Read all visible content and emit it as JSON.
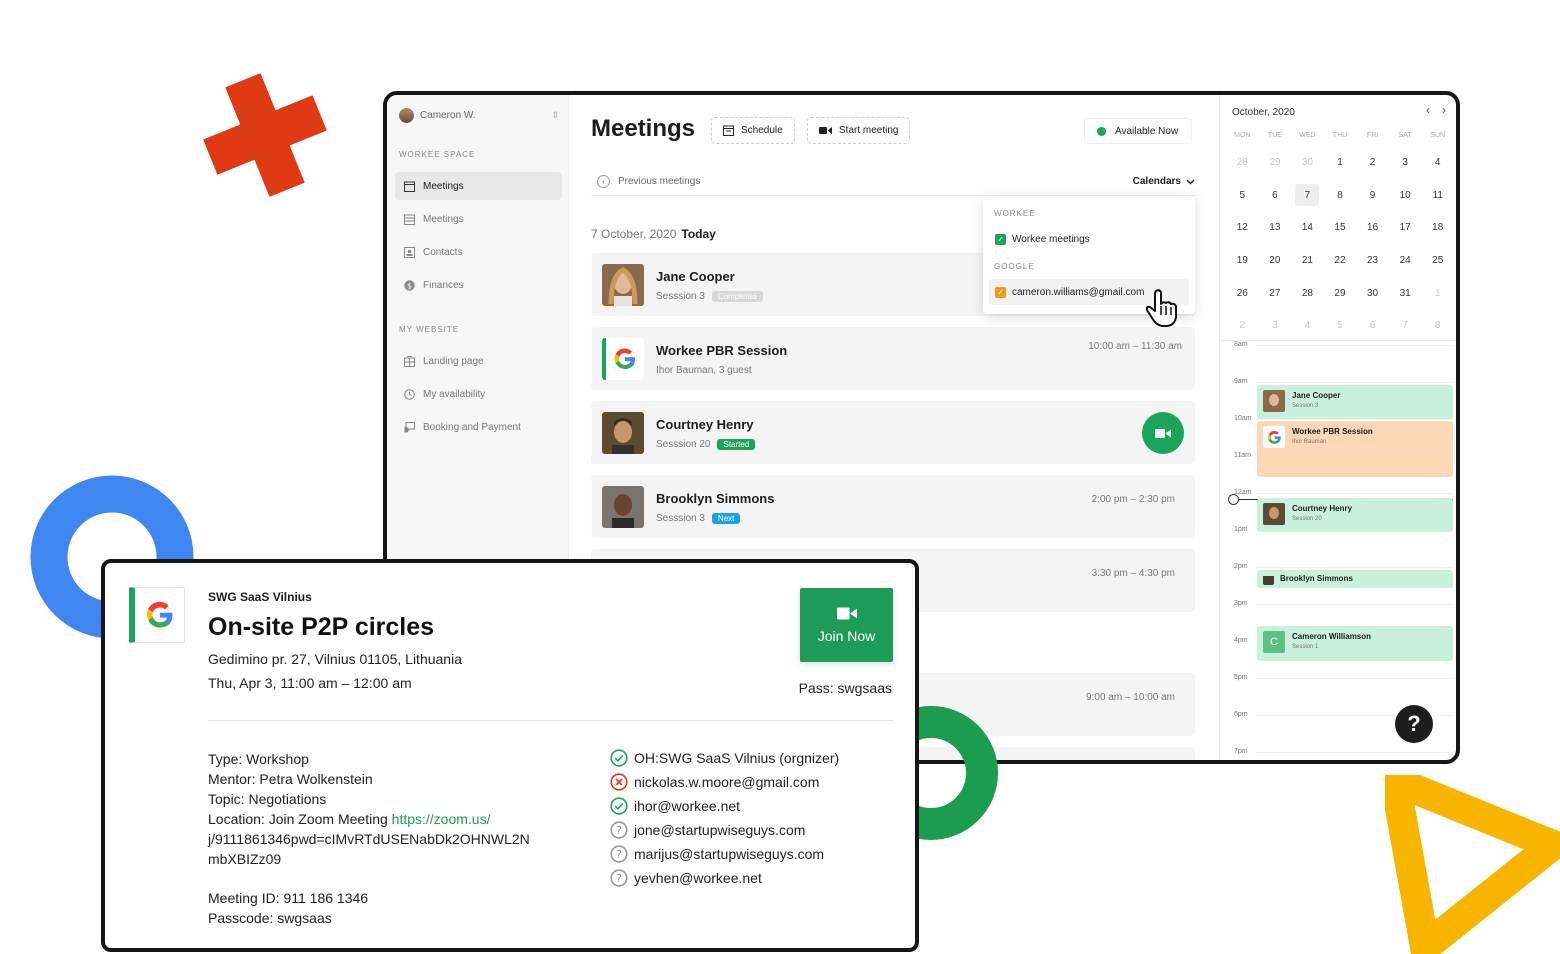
{
  "sidebar": {
    "user_name": "Cameron W.",
    "workspace_label": "WORKEE SPACE",
    "workspace_items": [
      {
        "label": "Meetings",
        "icon": "calendar-icon",
        "active": true
      },
      {
        "label": "Meetings",
        "icon": "calendar-grid-icon",
        "active": false
      },
      {
        "label": "Contacts",
        "icon": "contact-card-icon",
        "active": false
      },
      {
        "label": "Finances",
        "icon": "dollar-icon",
        "active": false
      }
    ],
    "website_label": "MY WEBSITE",
    "website_items": [
      {
        "label": "Landing page",
        "icon": "layout-icon"
      },
      {
        "label": "My availability",
        "icon": "clock-icon"
      },
      {
        "label": "Booking and Payment",
        "icon": "payment-icon"
      }
    ]
  },
  "main": {
    "title": "Meetings",
    "schedule_label": "Schedule",
    "start_meeting_label": "Start meeting",
    "available_label": "Available Now",
    "previous_meetings_label": "Previous meetings",
    "calendars_label": "Calendars",
    "date_label": "7 October, 2020",
    "today_label": "Today",
    "meetings": [
      {
        "name": "Jane Cooper",
        "sub": "Sesssion 3",
        "badge": "Completed",
        "time": ""
      },
      {
        "name": "Workee PBR Session",
        "sub": "Ihor Bauman, 3 guest",
        "badge": "",
        "time": "10:00 am – 11:30 am"
      },
      {
        "name": "Courtney Henry",
        "sub": "Sesssion 20",
        "badge": "Started",
        "time": ""
      },
      {
        "name": "Brooklyn Simmons",
        "sub": "Sesssion 3",
        "badge": "Next",
        "time": "2:00 pm – 2:30 pm"
      },
      {
        "name": "",
        "sub": "",
        "badge": "",
        "time": "3:30 pm – 4:30 pm"
      },
      {
        "name": "",
        "sub": "",
        "badge": "",
        "time": "9:00 am – 10:00 am"
      }
    ],
    "dropdown": {
      "workee_label": "WORKEE",
      "workee_item": "Workee meetings",
      "google_label": "GOOGLE",
      "google_item": "cameron.williams@gmail.com"
    }
  },
  "calendar": {
    "month": "October, 2020",
    "weekdays": [
      "MON",
      "TUE",
      "WED",
      "THU",
      "FRI",
      "SAT",
      "SUN"
    ],
    "selected_day": "7",
    "hours": [
      "8am",
      "9am",
      "10am",
      "11am",
      "12am",
      "1pm",
      "2pm",
      "3pm",
      "4pm",
      "5pm",
      "6pm",
      "7pm"
    ],
    "events": [
      {
        "name": "Jane Cooper",
        "sub": "Session 3"
      },
      {
        "name": "Workee PBR Session",
        "sub": "Ihor Bauman"
      },
      {
        "name": "Courtney Henry",
        "sub": "Session 20"
      },
      {
        "name": "Brooklyn Simmons",
        "sub": ""
      },
      {
        "name": "Cameron Williamson",
        "sub": "Session 1",
        "initial": "C"
      }
    ],
    "help_label": "?"
  },
  "detail": {
    "organizer": "SWG SaaS Vilnius",
    "title": "On-site P2P circles",
    "address": "Gedimino pr. 27, Vilnius 01105, Lithuania",
    "when": "Thu, Apr 3, 11:00 am – 12:00 am",
    "join_label": "Join Now",
    "pass_label": "Pass: swgsaas",
    "type": "Type: Workshop",
    "mentor": "Mentor: Petra Wolkenstein",
    "topic": "Topic: Negotiations",
    "location_prefix": "Location: Join Zoom Meeting",
    "location_link_1": "https://zoom.us/",
    "location_link_2": "j/9111861346pwd=cIMvRTdUSENabDk2OHNWL2N",
    "location_link_3": "mbXBIZz09",
    "meeting_id": "Meeting ID: 911 186 1346",
    "passcode": "Passcode: swgsaas",
    "attendees": [
      {
        "email": "OH:SWG SaaS Vilnius (orgnizer)",
        "status": "accepted"
      },
      {
        "email": "nickolas.w.moore@gmail.com",
        "status": "declined"
      },
      {
        "email": "ihor@workee.net",
        "status": "accepted"
      },
      {
        "email": "jone@startupwiseguys.com",
        "status": "unknown"
      },
      {
        "email": "marijus@startupwiseguys.com",
        "status": "unknown"
      },
      {
        "email": "yevhen@workee.net",
        "status": "unknown"
      }
    ]
  },
  "colors": {
    "green": "#19a55c",
    "blue": "#3f86f0",
    "red": "#e03a14",
    "yellow": "#f7b500",
    "event_green": "#c9f0dc",
    "event_orange": "#fdd8b6"
  }
}
